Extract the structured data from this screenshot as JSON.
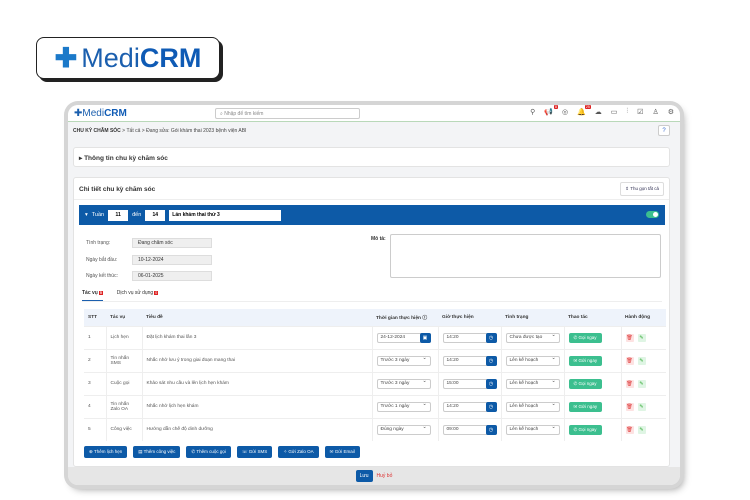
{
  "logo": {
    "text_a": "Medi",
    "text_b": "CRM"
  },
  "topbar": {
    "search_placeholder": "Nhập để tìm kiếm",
    "badges": [
      "8",
      "25"
    ]
  },
  "breadcrumb": {
    "root": "CHU KỲ CHĂM SÓC",
    "sep": ">",
    "all": "Tất cả",
    "current": "Đang sửa: Gói khám thai 2023 bệnh viện ABI"
  },
  "section1": {
    "title": "Thông tin chu kỳ chăm sóc"
  },
  "section2": {
    "title": "Chi tiết chu kỳ chăm sóc",
    "collapse_label": "Thu gọn tất cả",
    "week_label": "Tuần",
    "week_from": "11",
    "to_label": "đến",
    "week_to": "14",
    "stage_name": "Lần khám thai thứ 3",
    "enabled": true,
    "fields": [
      {
        "label": "Tình trạng:",
        "value": "Đang chăm sóc"
      },
      {
        "label": "Ngày bắt đầu:",
        "value": "10-12-2024"
      },
      {
        "label": "Ngày kết thúc:",
        "value": "06-01-2025"
      }
    ],
    "desc_label": "Mô tả:",
    "desc_value": ""
  },
  "tabs": [
    {
      "label": "Tác vụ",
      "badge": "5",
      "active": true
    },
    {
      "label": "Dịch vụ sử dụng",
      "badge": "0",
      "active": false
    }
  ],
  "table": {
    "headers": [
      "STT",
      "Tác vụ",
      "Tiêu đề",
      "Thời gian thực hiện",
      "Giờ thực hiện",
      "Tình trạng",
      "Thao tác",
      "Hành động"
    ],
    "rows": [
      {
        "stt": "1",
        "task": "Lịch hẹn",
        "title": "Đặt lịch khám thai lần 3",
        "time": "24-12-2024",
        "time_type": "date",
        "hour": "14:20",
        "status": "Chưa được tạo",
        "action": "Gọi ngay",
        "action_icon": "phone-icon"
      },
      {
        "stt": "2",
        "task": "Tin nhắn SMS",
        "title": "Nhắc nhở lưu ý trong giai đoạn mang thai",
        "time": "Trước 3 ngày",
        "time_type": "select",
        "hour": "14:20",
        "status": "Lên kế hoạch",
        "action": "Gửi ngay",
        "action_icon": "mail-icon"
      },
      {
        "stt": "3",
        "task": "Cuộc gọi",
        "title": "Khảo sát nhu cầu và lên lịch hẹn khám",
        "time": "Trước 3 ngày",
        "time_type": "select",
        "hour": "15:00",
        "status": "Lên kế hoạch",
        "action": "Gọi ngay",
        "action_icon": "phone-icon"
      },
      {
        "stt": "4",
        "task": "Tin nhắn Zalo OA",
        "title": "Nhắc nhở lịch hẹn khám",
        "time": "Trước 1 ngày",
        "time_type": "select",
        "hour": "14:20",
        "status": "Lên kế hoạch",
        "action": "Gửi ngay",
        "action_icon": "mail-icon"
      },
      {
        "stt": "5",
        "task": "Công việc",
        "title": "Hướng dẫn chế độ dinh dưỡng",
        "time": "Đúng ngày",
        "time_type": "select",
        "hour": "09:00",
        "status": "Lên kế hoạch",
        "action": "Gọi ngay",
        "action_icon": "phone-icon"
      }
    ]
  },
  "actions": [
    "Thêm lịch hẹn",
    "Thêm công việc",
    "Thêm cuộc gọi",
    "Gửi SMS",
    "Gửi Zalo OA",
    "Gửi Email"
  ],
  "footer": {
    "save": "Lưu",
    "cancel": "Huỷ bỏ"
  }
}
